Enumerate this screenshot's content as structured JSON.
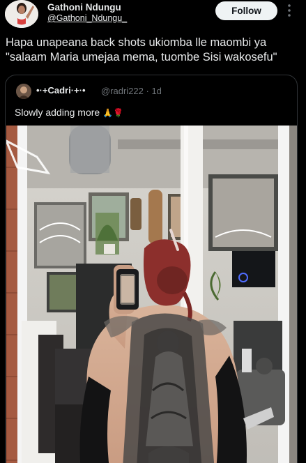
{
  "author": {
    "display_name": "Gathoni Ndungu",
    "handle": "@Gathoni_Ndungu_"
  },
  "follow_label": "Follow",
  "tweet_text": "Hapa unapeana back shots ukiomba lle maombi ya \"salaam Maria umejaa mema, tuombe Sisi wakosefu\"",
  "quoted": {
    "display_name": "•·+Cadri·+·•",
    "handle_meta": "@radri222 · 1d",
    "text": "Slowly adding more",
    "emojis": "🙏🌹"
  },
  "icons": {
    "more": "more-vertical-icon"
  },
  "colors": {
    "background": "#000000",
    "text": "#e7e9ea",
    "muted": "#71767b",
    "border": "#2f3336",
    "follow_bg": "#eff3f4"
  }
}
